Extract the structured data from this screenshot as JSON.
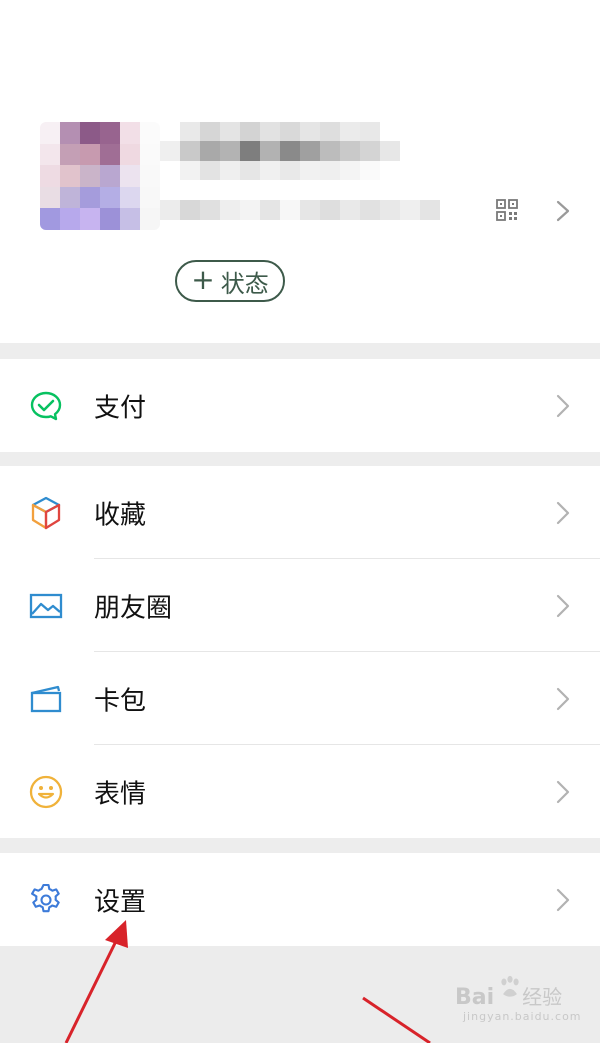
{
  "profile": {
    "status_button_label": "状态",
    "status_button_icon": "plus-icon",
    "qr_icon": "qr-code-icon",
    "chevron_icon": "chevron-right-icon"
  },
  "menu": {
    "group1": [
      {
        "label": "支付",
        "icon": "pay-icon",
        "color": "#07c160"
      }
    ],
    "group2": [
      {
        "label": "收藏",
        "icon": "favorites-cube-icon",
        "color": "#f2a03d"
      },
      {
        "label": "朋友圈",
        "icon": "moments-picture-icon",
        "color": "#2f8ccf"
      },
      {
        "label": "卡包",
        "icon": "card-wallet-icon",
        "color": "#2f8ccf"
      },
      {
        "label": "表情",
        "icon": "sticker-smile-icon",
        "color": "#f0b23a"
      }
    ],
    "group3": [
      {
        "label": "设置",
        "icon": "settings-gear-icon",
        "color": "#3d7bd9"
      }
    ]
  },
  "watermark": {
    "brand": "Bai",
    "brand_suffix": "经验",
    "sub": "jingyan.baidu.com"
  },
  "colors": {
    "background": "#ededed",
    "surface": "#ffffff",
    "accent_green": "#07c160",
    "annotation_red": "#d8232a"
  }
}
